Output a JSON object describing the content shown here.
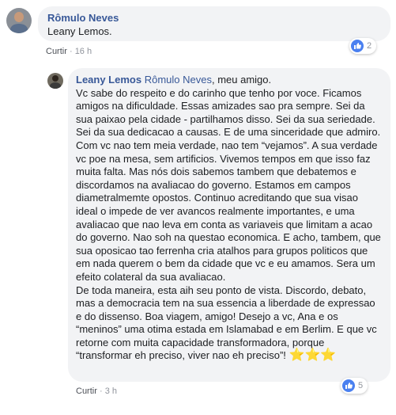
{
  "comment1": {
    "author": "Rômulo Neves",
    "text": "Leany Lemos.",
    "action": "Curtir",
    "separator": "·",
    "time": "16 h",
    "likes": "2"
  },
  "reply1": {
    "author": "Leany Lemos",
    "mention": "Rômulo Neves",
    "greeting": ", meu amigo.",
    "paragraph1": "Vc sabe do respeito e do carinho que tenho por voce. Ficamos amigos na dificuldade. Essas amizades sao pra sempre. Sei da sua paixao pela cidade - partilhamos disso. Sei da sua seriedade. Sei da sua dedicacao a causas. E de uma sinceridade que admiro. Com vc nao tem meia verdade, nao tem “vejamos”. A sua verdade vc poe na mesa, sem artificios. Vivemos tempos em que isso faz muita falta. Mas nós dois sabemos tambem que debatemos e discordamos na avaliacao do governo. Estamos em campos diametralmemte opostos. Continuo acreditando que sua visao ideal o impede de ver avancos realmente importantes, e uma avaliacao que nao leva em conta as variaveis que limitam a acao do governo. Nao soh na questao economica. E acho, tambem, que sua oposicao tao ferrenha cria atalhos para grupos politicos que em nada querem o bem da cidade que vc e eu amamos. Sera um efeito colateral da sua avaliacao.",
    "paragraph2": "De toda maneira, esta aih seu ponto de vista. Discordo, debato, mas a democracia tem na sua essencia a liberdade de expressao e do dissenso. Boa viagem, amigo! Desejo a vc, Ana e os “meninos” uma otima estada em Islamabad e em Berlim. E que vc retorne com muita capacidade transformadora, porque “transformar eh preciso, viver nao eh preciso”!",
    "stars": "⭐⭐⭐",
    "action": "Curtir",
    "separator": "·",
    "time": "3 h",
    "likes": "5"
  },
  "colors": {
    "name_link": "#385898",
    "bubble_bg": "#f2f3f5",
    "meta_text": "#90949c",
    "like_blue": "#4a80f0"
  }
}
